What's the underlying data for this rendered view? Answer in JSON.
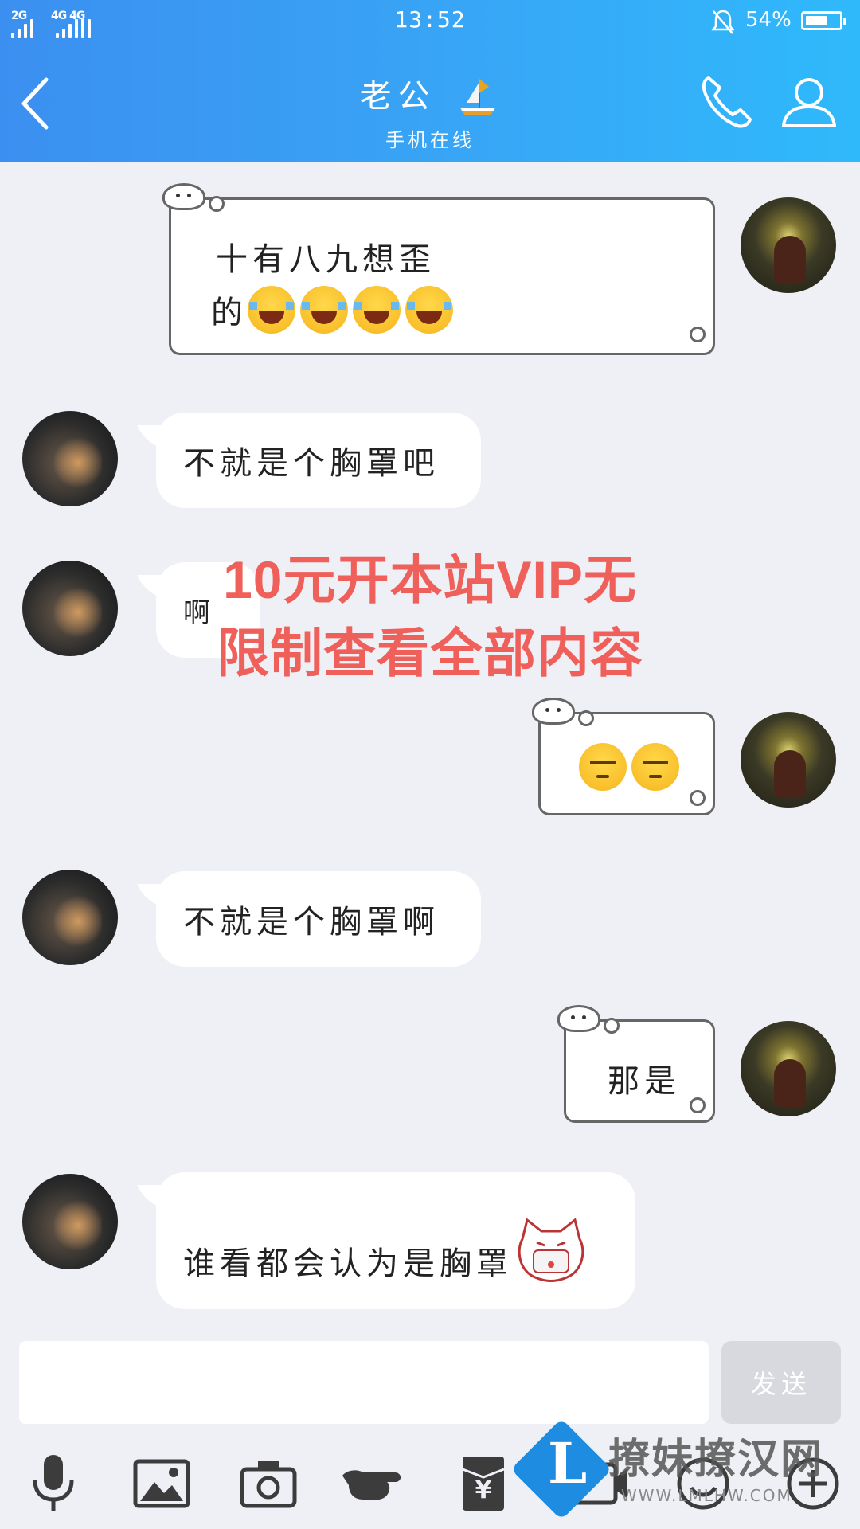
{
  "status_bar": {
    "network_left": "2G",
    "network_right": "4G 4G",
    "time": "13:52",
    "battery": "54%"
  },
  "header": {
    "title": "老公",
    "subtitle": "手机在线"
  },
  "messages": [
    {
      "from": "me",
      "text": "十有八九想歪",
      "text2": "的",
      "emoji": [
        "laugh",
        "laugh",
        "laugh",
        "laugh"
      ]
    },
    {
      "from": "peer",
      "text": "不就是个胸罩吧"
    },
    {
      "from": "peer",
      "text": "啊"
    },
    {
      "from": "me",
      "text": "",
      "emoji": [
        "meh",
        "meh"
      ]
    },
    {
      "from": "peer",
      "text": "不就是个胸罩啊"
    },
    {
      "from": "me",
      "text": "那是"
    },
    {
      "from": "peer",
      "text": "谁看都会认为是胸罩"
    }
  ],
  "promo": {
    "line1": "10元开本站VIP无",
    "line2": "限制查看全部内容"
  },
  "input": {
    "placeholder": "",
    "send_label": "发送"
  },
  "toolbar": [
    "mic-icon",
    "image-icon",
    "camera-icon",
    "pointer-icon",
    "red-packet-icon",
    "gif-icon",
    "emoji-icon",
    "plus-icon"
  ],
  "watermark": {
    "text": "撩妹撩汉网",
    "url": "WWW.LMLHW.COM"
  },
  "colors": {
    "header_start": "#3b8ff0",
    "header_end": "#2fb9fb",
    "promo": "#f0605a",
    "background": "#eef0f6"
  }
}
